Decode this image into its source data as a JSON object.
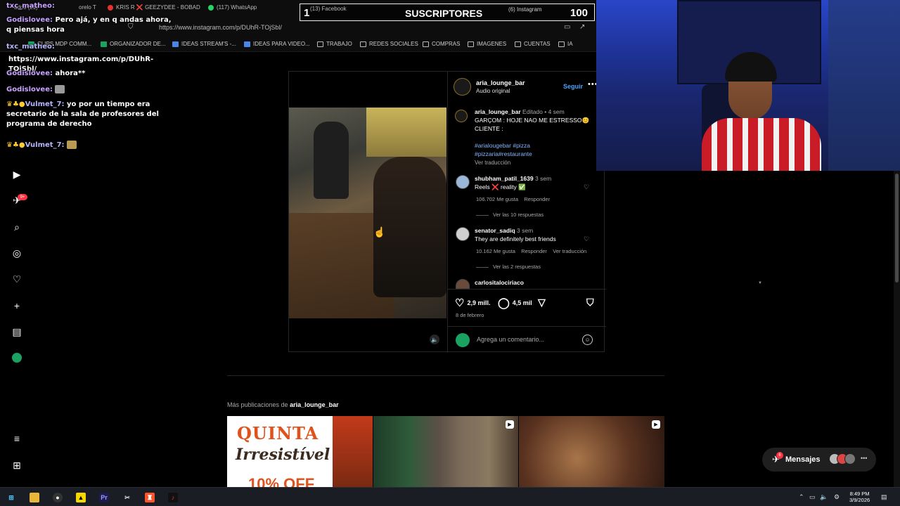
{
  "browser": {
    "tabs": [
      {
        "label": "KRIS R ❌ GEEZYDEE - BOBAD",
        "dot": "#e5322d"
      },
      {
        "label": "(117) WhatsApp",
        "dot": "#25d366"
      }
    ],
    "tab_fragments": [
      "ados (21)",
      "orelo T"
    ],
    "url": "https://www.instagram.com/p/DUhR-TOjSbl/",
    "bookmarks": [
      "CLIPS MDP COMM...",
      "ORGANIZADOR DE...",
      "IDEAS STREAM'S -...",
      "IDEAS PARA VIDEO...",
      "TRABAJO",
      "REDES SOCIALES",
      "COMPRAS",
      "IMAGENES",
      "CUENTAS",
      "IA"
    ]
  },
  "overlay": {
    "subs_label": "SUSCRIPTORES",
    "subs_count": "100",
    "left_number": "1",
    "facebook_tab": "(13) Facebook",
    "instagram_tab": "(6) Instagram"
  },
  "chat": [
    {
      "user": "txc_matheo:",
      "text": ""
    },
    {
      "user": "Godislovee:",
      "text": "Pero ajá, y en q andas ahora, q piensas hora"
    },
    {
      "user": "txc_matheo:",
      "text": ""
    },
    {
      "user": "",
      "text": "https://www.instagram.com/p/DUhR-TOjSbl/"
    },
    {
      "user": "Godislovee:",
      "text": "ahora**"
    },
    {
      "user": "Godislovee:",
      "text": ""
    },
    {
      "user": "Vulmet_7:",
      "text": "yo por un tiempo era secretario de la sala de profesores del programa de derecho"
    },
    {
      "user": "Vulmet_7:",
      "text": ""
    }
  ],
  "rail": {
    "notif_badge": "9+"
  },
  "post": {
    "account": "aria_lounge_bar",
    "audio": "Audio original",
    "follow": "Seguir",
    "more": "•••",
    "caption": {
      "user": "aria_lounge_bar",
      "edited": "Editado • 4 sem",
      "text1": "GARÇOM : HOJE NAO ME ESTRESSO😊",
      "text2": "CLIENTE :",
      "tags1": "#arialougebar #pizza",
      "tags2": "#pizzaria#restaurante",
      "translate": "Ver traducción"
    },
    "comments": [
      {
        "user": "shubham_patil_1639",
        "time": "3 sem",
        "text": "Reels ❌ reality ✅",
        "likes": "106.702 Me gusta",
        "reply": "Responder",
        "translate": "",
        "replies": "Ver las 10 respuestas"
      },
      {
        "user": "senator_sadiq",
        "time": "3 sem",
        "text": "They are definitely best friends",
        "likes": "10.162 Me gusta",
        "reply": "Responder",
        "translate": "Ver traducción",
        "replies": "Ver las 2 respuestas"
      },
      {
        "user": "carlositalociriaco",
        "time": "",
        "text": "",
        "likes": "",
        "reply": "",
        "translate": "",
        "replies": ""
      }
    ],
    "likes": "2,9 mill.",
    "comments_count": "4,5 mil",
    "date": "8 de febrero",
    "comment_placeholder": "Agrega un comentario..."
  },
  "more_posts": {
    "prefix": "Más publicaciones de",
    "account": "aria_lounge_bar",
    "thumb1_line1": "QUINTA",
    "thumb1_line2": "Irresistível",
    "thumb1_line3": "10% OFF"
  },
  "messages": {
    "label": "Mensajes",
    "badge": "6"
  },
  "taskbar": {
    "time": "8:49 PM",
    "date": "3/9/2026"
  },
  "colors": {
    "ig_link": "#4aa3ff",
    "chat_user": "#c8a2ff",
    "badge": "#ff3040"
  }
}
